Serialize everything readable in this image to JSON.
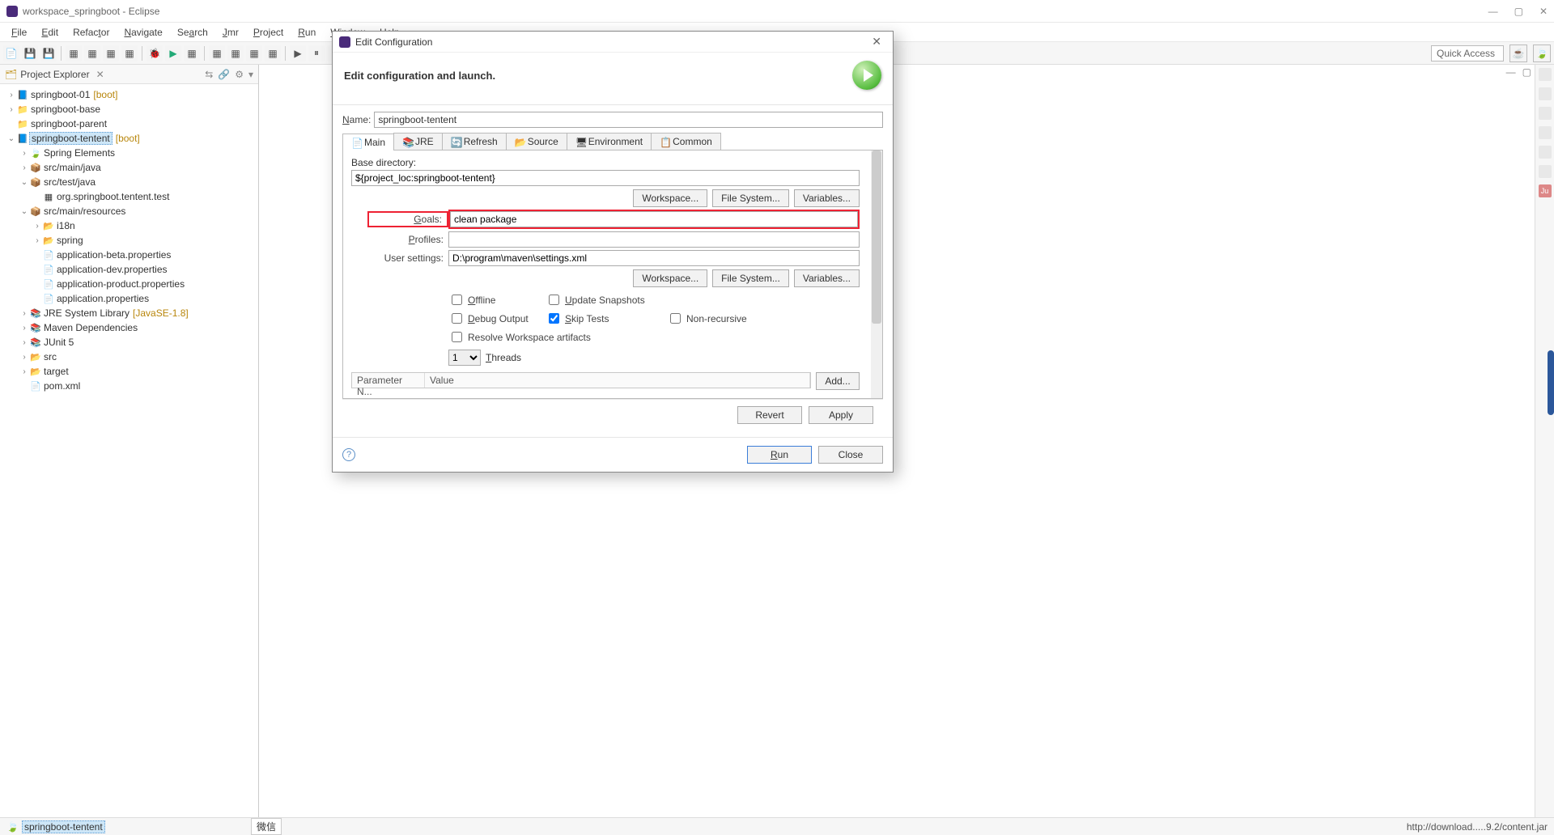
{
  "window": {
    "title": "workspace_springboot - Eclipse"
  },
  "menu": [
    "File",
    "Edit",
    "Refactor",
    "Navigate",
    "Search",
    "Jmr",
    "Project",
    "Run",
    "Window",
    "Help"
  ],
  "quick_access": "Quick Access",
  "explorer": {
    "title": "Project Explorer",
    "tree": [
      {
        "ind": 1,
        "tw": ">",
        "ic": "📘",
        "lbl": "springboot-01",
        "deco": "[boot]"
      },
      {
        "ind": 1,
        "tw": ">",
        "ic": "📁",
        "lbl": "springboot-base"
      },
      {
        "ind": 1,
        "tw": "",
        "ic": "📁",
        "lbl": "springboot-parent"
      },
      {
        "ind": 1,
        "tw": "v",
        "ic": "📘",
        "lbl": "springboot-tentent",
        "deco": "[boot]",
        "sel": true
      },
      {
        "ind": 2,
        "tw": ">",
        "ic": "🍃",
        "lbl": "Spring Elements"
      },
      {
        "ind": 2,
        "tw": ">",
        "ic": "📦",
        "lbl": "src/main/java"
      },
      {
        "ind": 2,
        "tw": "v",
        "ic": "📦",
        "lbl": "src/test/java"
      },
      {
        "ind": 3,
        "tw": "",
        "ic": "▦",
        "lbl": "org.springboot.tentent.test"
      },
      {
        "ind": 2,
        "tw": "v",
        "ic": "📦",
        "lbl": "src/main/resources"
      },
      {
        "ind": 3,
        "tw": ">",
        "ic": "📂",
        "lbl": "i18n"
      },
      {
        "ind": 3,
        "tw": ">",
        "ic": "📂",
        "lbl": "spring"
      },
      {
        "ind": 3,
        "tw": "",
        "ic": "📄",
        "lbl": "application-beta.properties"
      },
      {
        "ind": 3,
        "tw": "",
        "ic": "📄",
        "lbl": "application-dev.properties"
      },
      {
        "ind": 3,
        "tw": "",
        "ic": "📄",
        "lbl": "application-product.properties"
      },
      {
        "ind": 3,
        "tw": "",
        "ic": "📄",
        "lbl": "application.properties"
      },
      {
        "ind": 2,
        "tw": ">",
        "ic": "📚",
        "lbl": "JRE System Library",
        "deco": "[JavaSE-1.8]"
      },
      {
        "ind": 2,
        "tw": ">",
        "ic": "📚",
        "lbl": "Maven Dependencies"
      },
      {
        "ind": 2,
        "tw": ">",
        "ic": "📚",
        "lbl": "JUnit 5"
      },
      {
        "ind": 2,
        "tw": ">",
        "ic": "📂",
        "lbl": "src"
      },
      {
        "ind": 2,
        "tw": ">",
        "ic": "📂",
        "lbl": "target"
      },
      {
        "ind": 2,
        "tw": "",
        "ic": "📄",
        "lbl": "pom.xml"
      }
    ]
  },
  "status": {
    "left": "springboot-tentent",
    "mid": "微信",
    "right": "http://download.....9.2/content.jar"
  },
  "dialog": {
    "title": "Edit Configuration",
    "heading": "Edit configuration and launch.",
    "name_label": "Name:",
    "name_value": "springboot-tentent",
    "tabs": [
      "Main",
      "JRE",
      "Refresh",
      "Source",
      "Environment",
      "Common"
    ],
    "base_dir_label": "Base directory:",
    "base_dir_value": "${project_loc:springboot-tentent}",
    "workspace_btn": "Workspace...",
    "filesystem_btn": "File System...",
    "variables_btn": "Variables...",
    "goals_label": "Goals:",
    "goals_value": "clean package",
    "profiles_label": "Profiles:",
    "profiles_value": "",
    "usersettings_label": "User settings:",
    "usersettings_value": "D:\\program\\maven\\settings.xml",
    "checks": {
      "offline": "Offline",
      "update_snapshots": "Update Snapshots",
      "debug_output": "Debug Output",
      "skip_tests": "Skip Tests",
      "non_recursive": "Non-recursive",
      "resolve_workspace": "Resolve Workspace artifacts"
    },
    "threads_value": "1",
    "threads_label": "Threads",
    "param_name_col": "Parameter N...",
    "param_value_col": "Value",
    "add_btn": "Add...",
    "revert_btn": "Revert",
    "apply_btn": "Apply",
    "run_btn": "Run",
    "close_btn": "Close"
  }
}
